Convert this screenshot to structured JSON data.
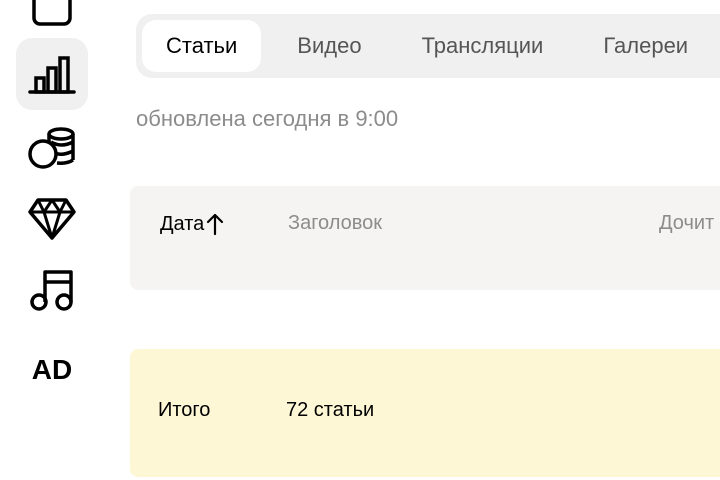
{
  "sidebar": {
    "items": [
      {
        "icon": "square-icon"
      },
      {
        "icon": "bar-chart-icon",
        "active": true
      },
      {
        "icon": "coins-icon"
      },
      {
        "icon": "diamond-icon"
      },
      {
        "icon": "music-note-icon"
      },
      {
        "icon": "ad-icon",
        "label": "AD"
      }
    ]
  },
  "tabs": [
    {
      "label": "Статьи",
      "active": true
    },
    {
      "label": "Видео"
    },
    {
      "label": "Трансляции"
    },
    {
      "label": "Галереи"
    }
  ],
  "updated_text": "обновлена сегодня в 9:00",
  "table": {
    "columns": [
      {
        "label": "Дата",
        "sort_icon": "arrow-up-icon"
      },
      {
        "label": "Заголовок"
      },
      {
        "label": "Дочит"
      }
    ]
  },
  "total": {
    "label": "Итого",
    "value": "72 статьи"
  }
}
